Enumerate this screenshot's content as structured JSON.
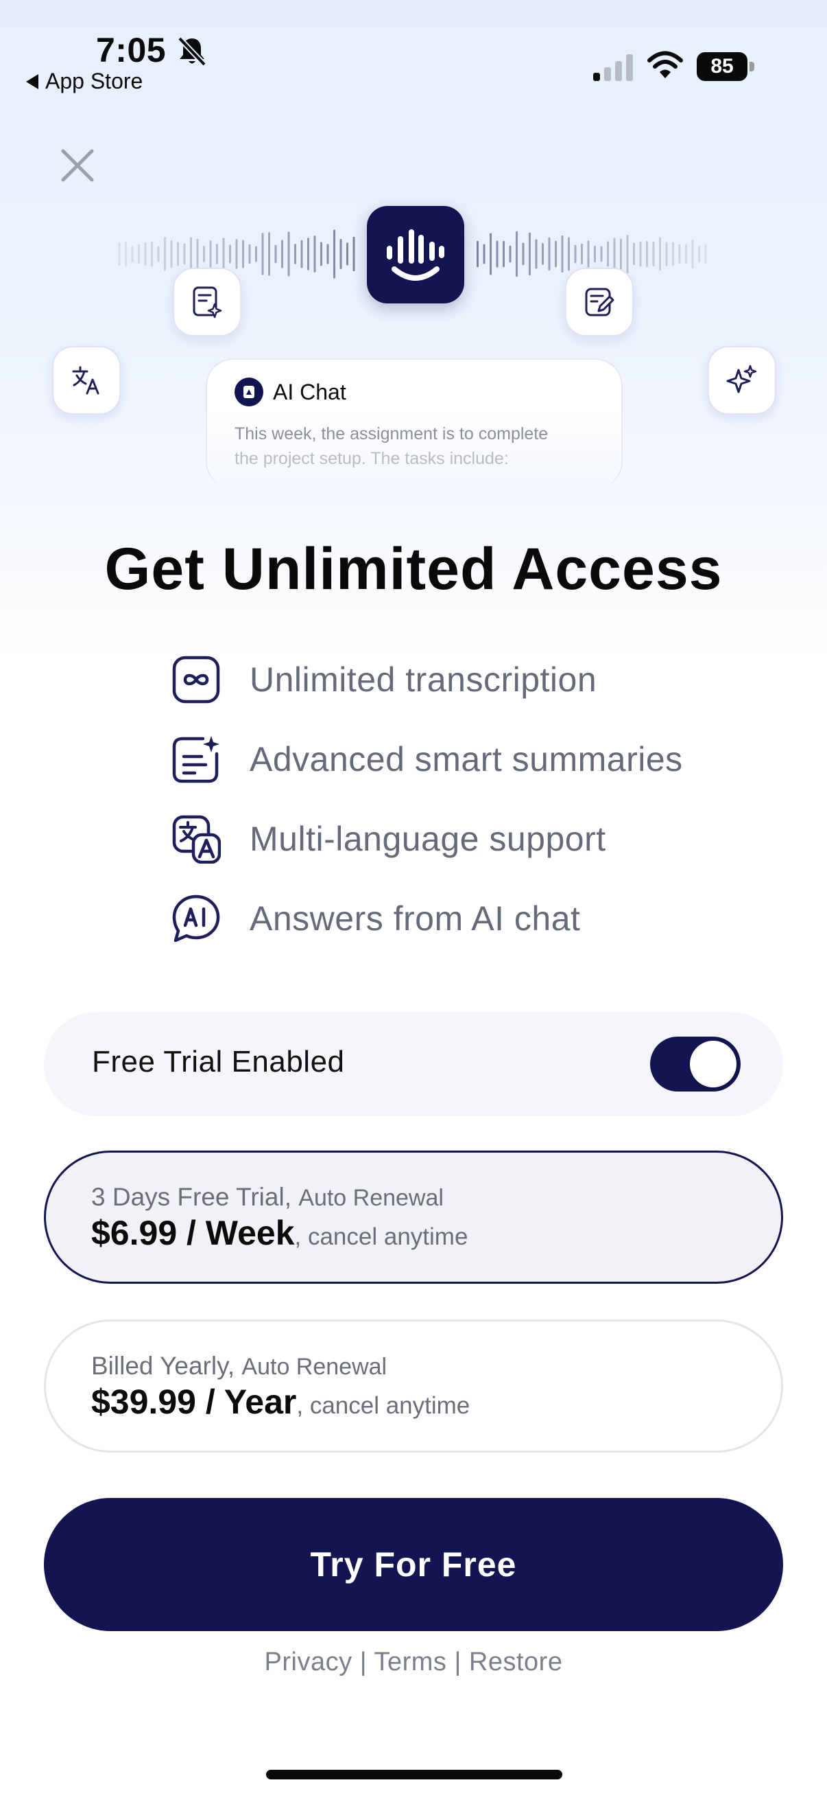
{
  "status_bar": {
    "time": "7:05",
    "back_label": "App Store",
    "battery": "85"
  },
  "hero": {
    "chat_title": "AI Chat",
    "chat_line1": "This week, the assignment is to complete",
    "chat_line2": "the project setup. The tasks include:"
  },
  "headline": "Get Unlimited Access",
  "features": [
    {
      "icon": "infinity-icon",
      "text": "Unlimited transcription"
    },
    {
      "icon": "summary-sparkle-icon",
      "text": "Advanced smart summaries"
    },
    {
      "icon": "translate-icon",
      "text": "Multi-language support"
    },
    {
      "icon": "ai-chat-bubble-icon",
      "text": "Answers from AI chat"
    }
  ],
  "trial": {
    "label": "Free Trial Enabled",
    "enabled": true
  },
  "plans": [
    {
      "line1_main": "3 Days Free Trial,",
      "line1_sub": "Auto Renewal",
      "price": "$6.99 / Week",
      "price_sub": ", cancel anytime",
      "selected": true
    },
    {
      "line1_main": "Billed Yearly,",
      "line1_sub": "Auto Renewal",
      "price": "$39.99 / Year",
      "price_sub": ", cancel anytime",
      "selected": false
    }
  ],
  "cta_label": "Try For Free",
  "footer": {
    "privacy": "Privacy",
    "sep": "|",
    "terms": "Terms",
    "restore": "Restore"
  },
  "colors": {
    "brand_navy": "#131552",
    "muted_text": "#646a7a"
  }
}
